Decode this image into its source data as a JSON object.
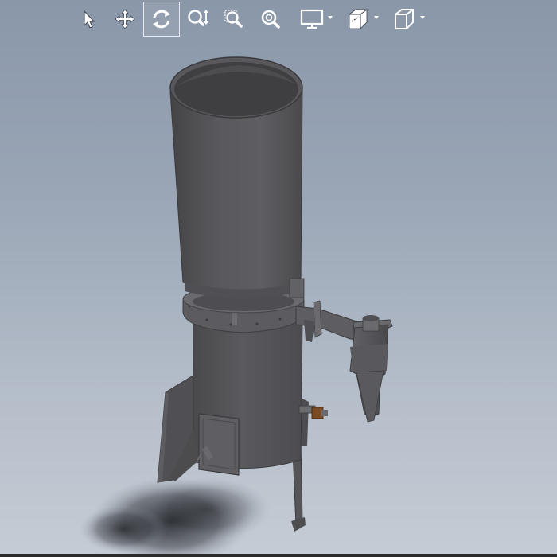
{
  "toolbar": {
    "buttons": [
      {
        "id": "select",
        "icon": "select-arrow-icon",
        "has_dropdown": false,
        "active": false
      },
      {
        "id": "pan",
        "icon": "pan-move-icon",
        "has_dropdown": false,
        "active": false
      },
      {
        "id": "rotate",
        "icon": "rotate-orbit-icon",
        "has_dropdown": false,
        "active": true
      },
      {
        "id": "zoom",
        "icon": "zoom-icon",
        "has_dropdown": false,
        "active": false
      },
      {
        "id": "zoom-window",
        "icon": "zoom-window-icon",
        "has_dropdown": false,
        "active": false
      },
      {
        "id": "zoom-fit",
        "icon": "zoom-fit-icon",
        "has_dropdown": false,
        "active": false
      },
      {
        "id": "display-style",
        "icon": "display-monitor-icon",
        "has_dropdown": true,
        "active": false
      },
      {
        "id": "section-view",
        "icon": "section-cube-icon",
        "has_dropdown": true,
        "active": false
      },
      {
        "id": "view-orientation",
        "icon": "view-cube-icon",
        "has_dropdown": true,
        "active": false
      }
    ]
  },
  "colors": {
    "background_top": "#8a97a9",
    "background_bottom": "#c6ccd5",
    "model_dark": "#4a4a4d",
    "model_mid": "#5b5b5f",
    "model_light": "#6f6f73",
    "accent_valve": "#7a4a22",
    "toolbar_icon": "#ffffff"
  },
  "model": {
    "name": "3d-model-separator-assembly"
  }
}
